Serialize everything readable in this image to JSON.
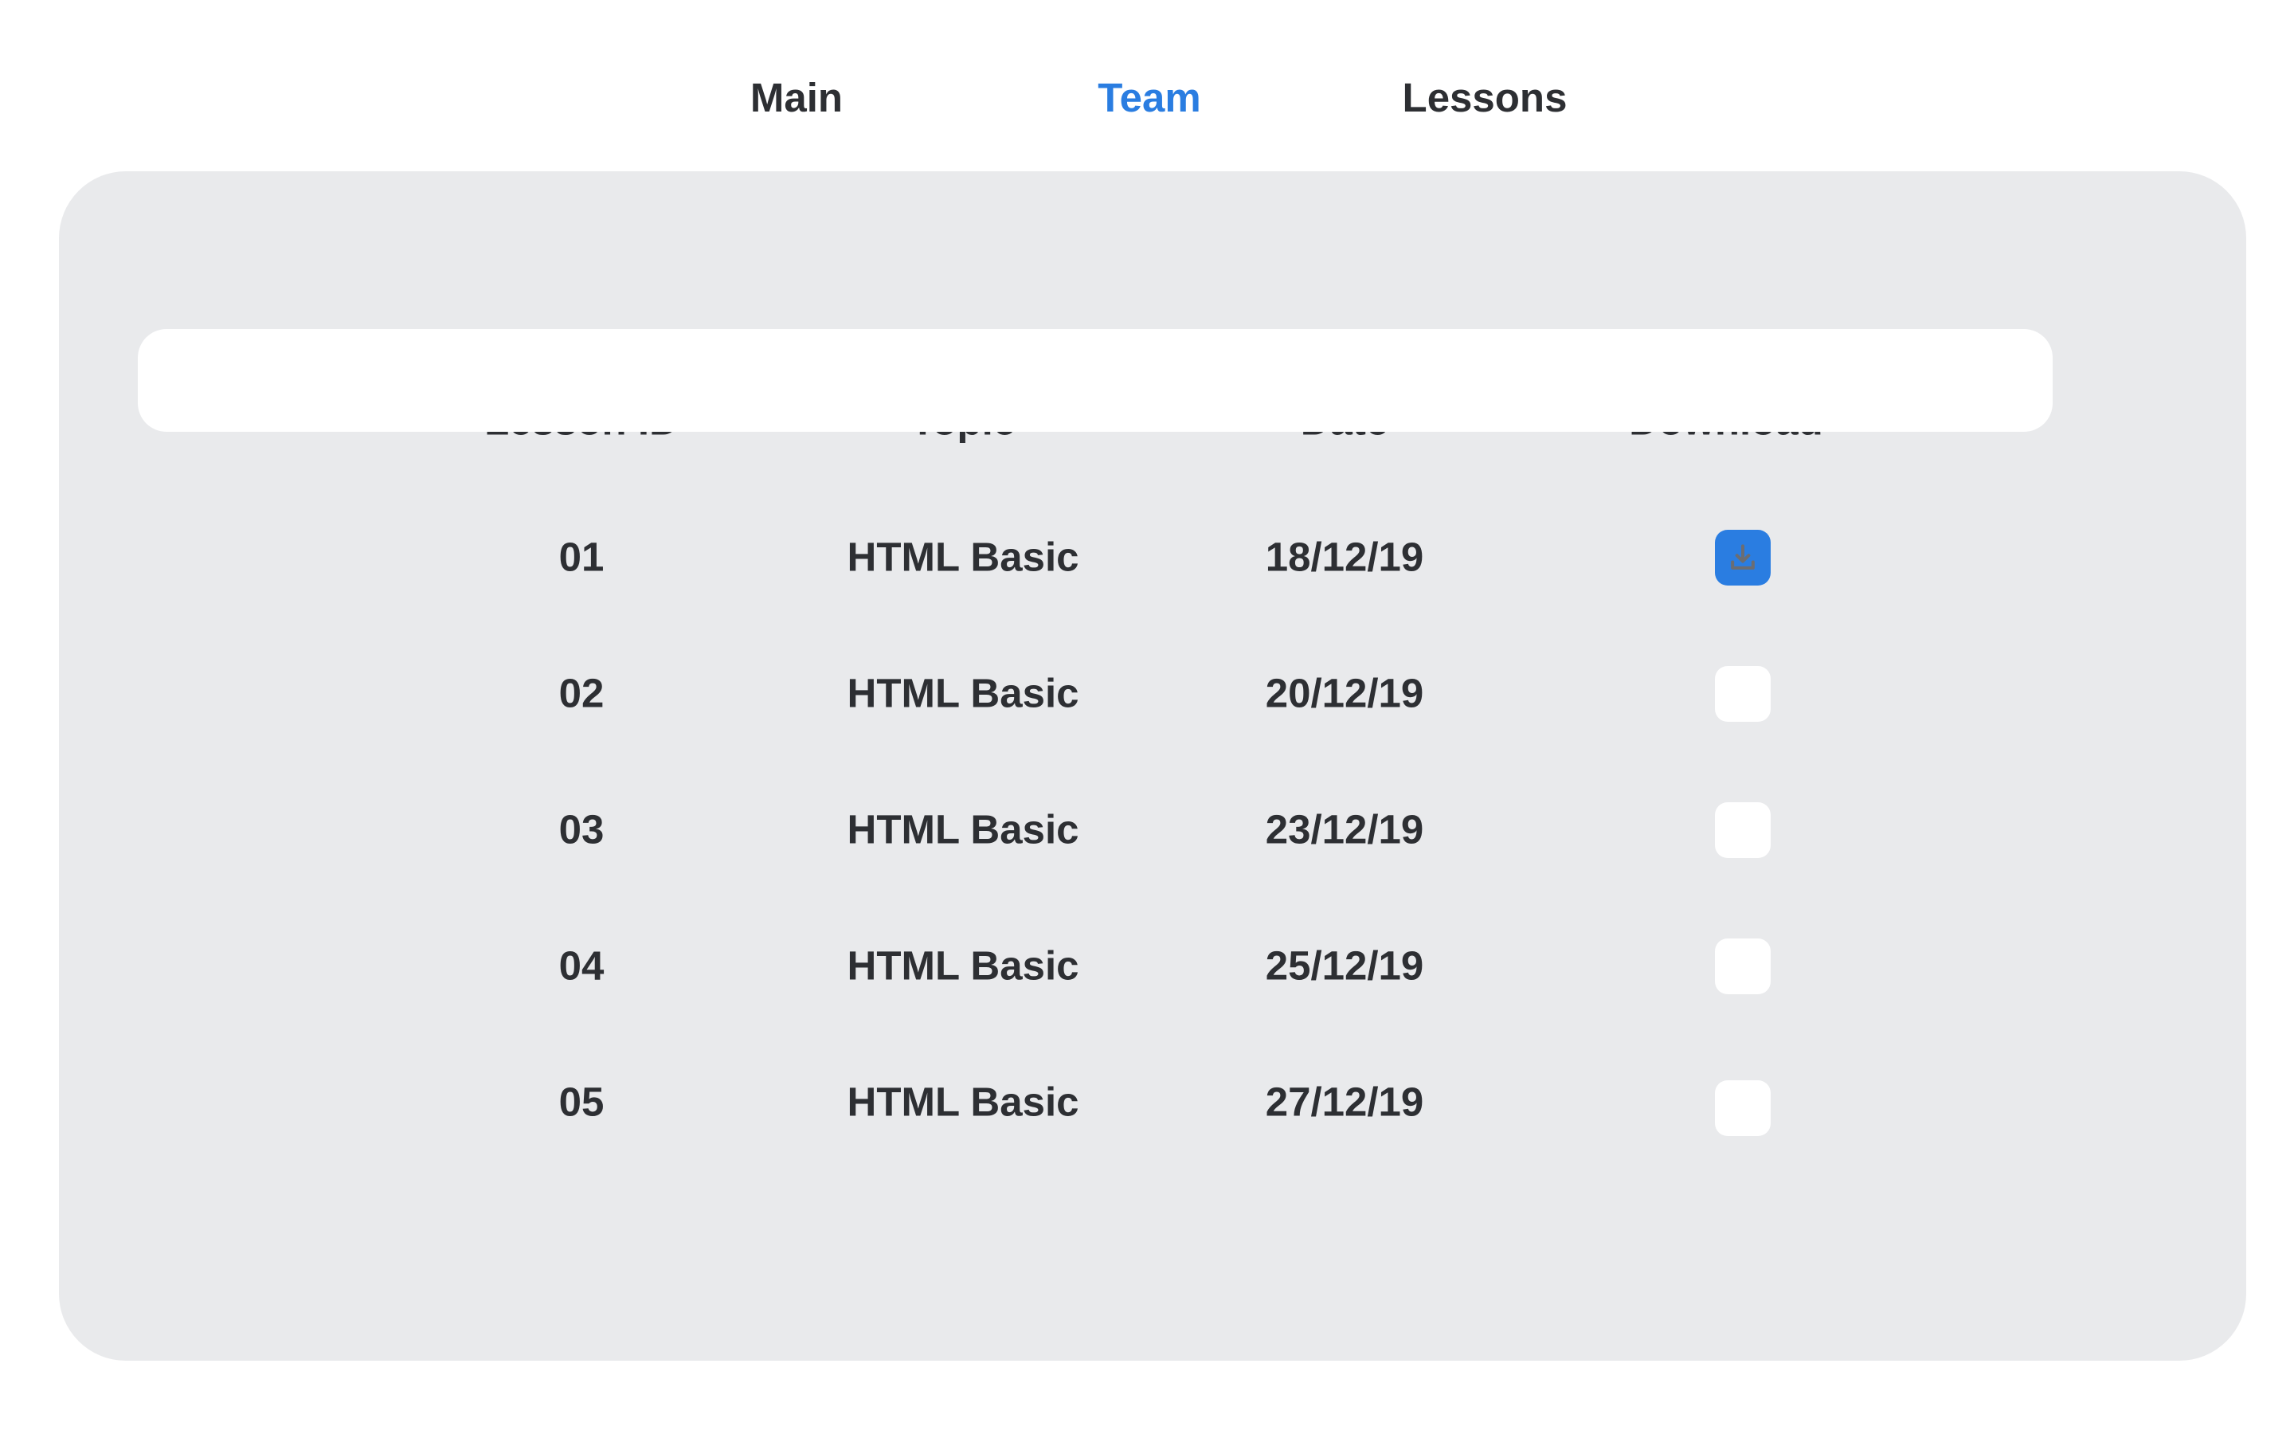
{
  "nav": {
    "items": [
      {
        "label": "Main",
        "active": false
      },
      {
        "label": "Team",
        "active": true
      },
      {
        "label": "Lessons",
        "active": false
      }
    ]
  },
  "table": {
    "headers": [
      "Lesson ID",
      "Topic",
      "Date",
      "Download"
    ],
    "rows": [
      {
        "id": "01",
        "topic": "HTML Basic",
        "date": "18/12/19",
        "selected": true
      },
      {
        "id": "02",
        "topic": "HTML Basic",
        "date": "20/12/19",
        "selected": false
      },
      {
        "id": "03",
        "topic": "HTML Basic",
        "date": "23/12/19",
        "selected": false
      },
      {
        "id": "04",
        "topic": "HTML Basic",
        "date": "25/12/19",
        "selected": false
      },
      {
        "id": "05",
        "topic": "HTML Basic",
        "date": "27/12/19",
        "selected": false
      }
    ],
    "download_icon": "download-icon"
  },
  "colors": {
    "accent": "#2a7de1",
    "panel": "#e9eaec",
    "text": "#2d2f33",
    "row_highlight": "#ffffff"
  }
}
